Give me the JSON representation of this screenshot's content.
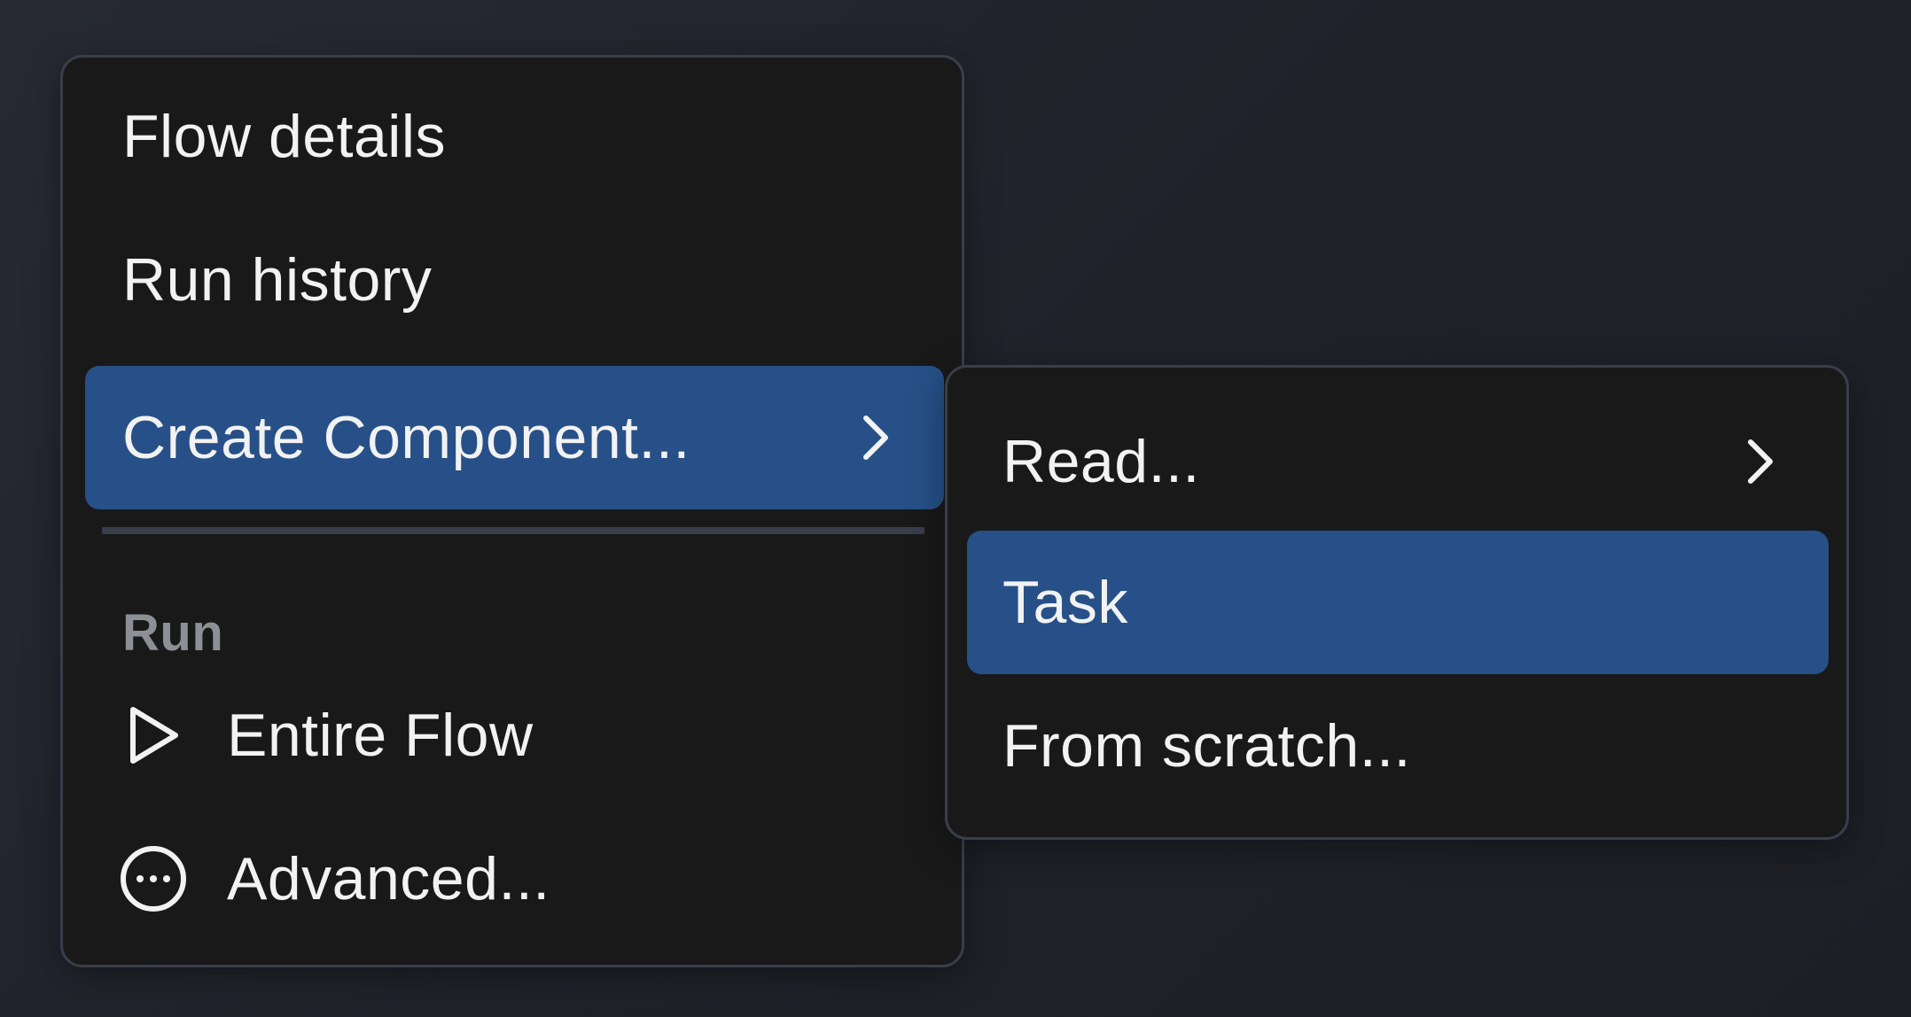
{
  "main_menu": {
    "items": [
      {
        "label": "Flow details"
      },
      {
        "label": "Run history"
      },
      {
        "label": "Create Component..."
      }
    ],
    "section_label": "Run",
    "run_items": [
      {
        "label": "Entire Flow",
        "icon": "play-icon"
      },
      {
        "label": "Advanced...",
        "icon": "more-circle-icon"
      }
    ]
  },
  "sub_menu": {
    "items": [
      {
        "label": "Read..."
      },
      {
        "label": "Task"
      },
      {
        "label": "From scratch..."
      }
    ]
  },
  "colors": {
    "highlight": "#265087",
    "menu_bg": "#19191a",
    "border": "#3a3d4a",
    "muted_text": "#8d8f96"
  }
}
